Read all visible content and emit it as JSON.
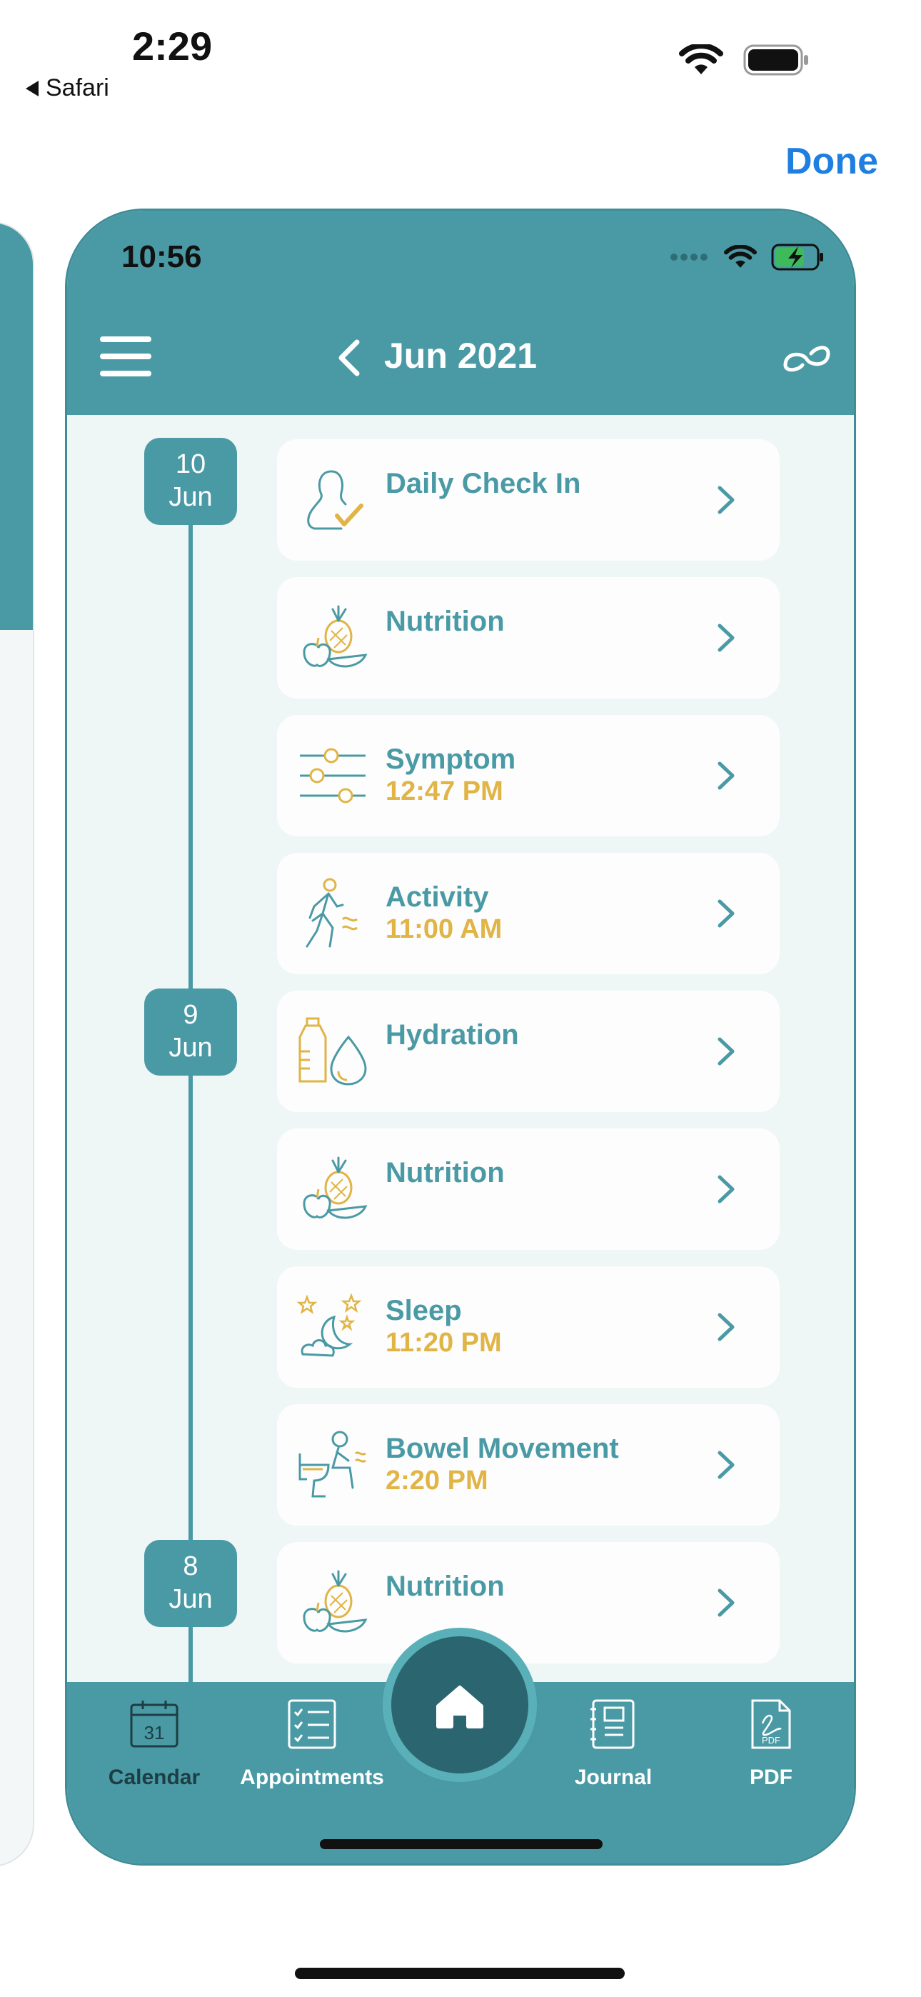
{
  "os_status": {
    "time": "2:29",
    "back_label": "Safari"
  },
  "sheet": {
    "done_label": "Done"
  },
  "app": {
    "status_time": "10:56",
    "header_title": "Jun 2021"
  },
  "timeline": {
    "dates": [
      {
        "day": "10",
        "month": "Jun"
      },
      {
        "day": "9",
        "month": "Jun"
      },
      {
        "day": "8",
        "month": "Jun"
      }
    ],
    "entries": [
      {
        "title": "Daily Check In",
        "time": "",
        "icon": "person-check-icon"
      },
      {
        "title": "Nutrition",
        "time": "",
        "icon": "fruits-icon"
      },
      {
        "title": "Symptom",
        "time": "12:47 PM",
        "icon": "sliders-icon"
      },
      {
        "title": "Activity",
        "time": "11:00 AM",
        "icon": "walking-person-icon"
      },
      {
        "title": "Hydration",
        "time": "",
        "icon": "water-bottle-icon"
      },
      {
        "title": "Nutrition",
        "time": "",
        "icon": "fruits-icon"
      },
      {
        "title": "Sleep",
        "time": "11:20 PM",
        "icon": "moon-stars-icon"
      },
      {
        "title": "Bowel Movement",
        "time": "2:20 PM",
        "icon": "toilet-icon"
      },
      {
        "title": "Nutrition",
        "time": "",
        "icon": "fruits-icon"
      }
    ]
  },
  "tabbar": {
    "calendar_label": "Calendar",
    "calendar_day": "31",
    "appointments_label": "Appointments",
    "journal_label": "Journal",
    "pdf_label": "PDF",
    "pdf_icon_text": "PDF"
  },
  "colors": {
    "teal": "#4a9aa5",
    "gold": "#e0b445",
    "dark_teal": "#2b6670",
    "done_blue": "#1f7fe0"
  }
}
